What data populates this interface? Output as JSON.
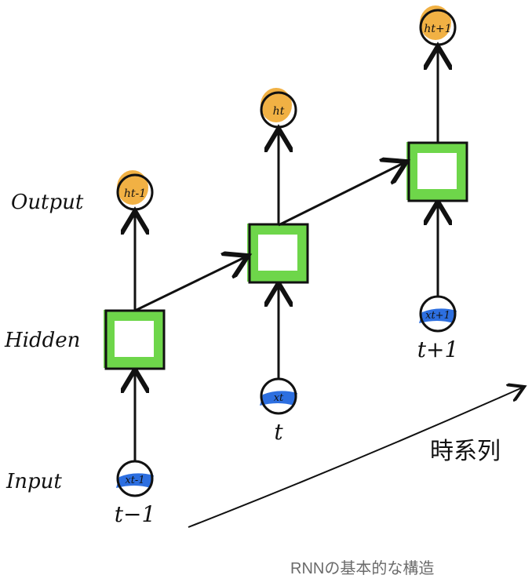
{
  "labels": {
    "output": "Output",
    "hidden": "Hidden",
    "input": "Input"
  },
  "steps": [
    {
      "time": "t−1",
      "output": "ht-1",
      "input": "xt-1"
    },
    {
      "time": "t",
      "output": "ht",
      "input": "xt"
    },
    {
      "time": "t+1",
      "output": "ht+1",
      "input": "xt+1"
    }
  ],
  "time_axis": "時系列",
  "caption": "RNNの基本的な構造",
  "colors": {
    "output": "#f0a830",
    "hidden": "#6ed64a",
    "input": "#2d6fe0"
  }
}
